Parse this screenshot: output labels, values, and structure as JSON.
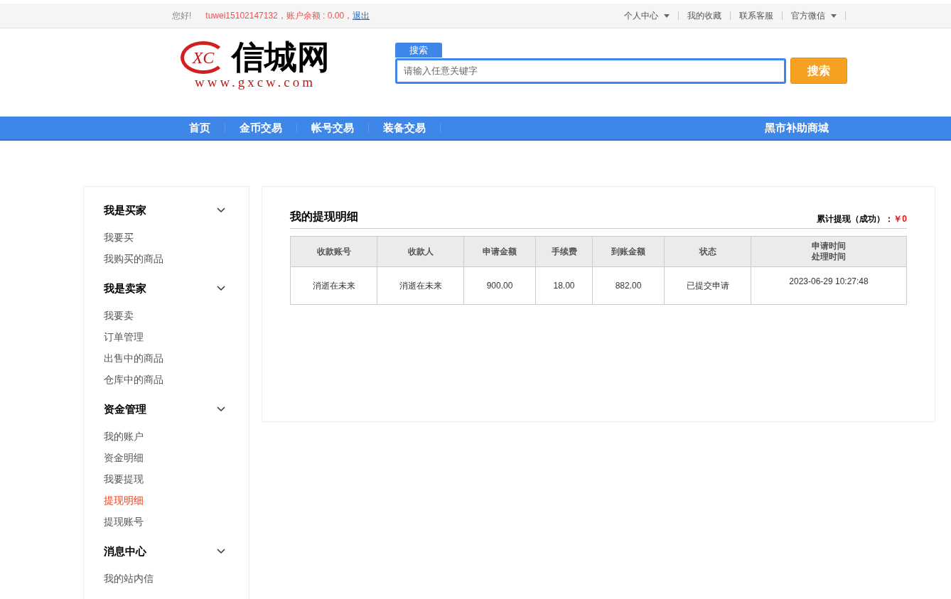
{
  "top_bar": {
    "greeting": "您好!",
    "username": "tuwei15102147132",
    "balance": "，账户余额 : 0.00，",
    "logout": "退出",
    "links": [
      {
        "label": "个人中心",
        "dropdown": true
      },
      {
        "label": "我的收藏",
        "dropdown": false
      },
      {
        "label": "联系客服",
        "dropdown": false
      },
      {
        "label": "官方微信",
        "dropdown": true
      }
    ]
  },
  "logo": {
    "mark": "XC",
    "name": "信城网",
    "url": "www.gxcw.com"
  },
  "search": {
    "tab": "搜索",
    "placeholder": "请输入任意关键字",
    "button": "搜索"
  },
  "nav": {
    "items": [
      "首页",
      "金币交易",
      "帐号交易",
      "装备交易"
    ],
    "right": "黑市补助商城"
  },
  "sidebar": [
    {
      "title": "我是买家",
      "expanded": true,
      "items": [
        {
          "label": "我要买",
          "selected": false
        },
        {
          "label": "我购买的商品",
          "selected": false
        }
      ]
    },
    {
      "title": "我是卖家",
      "expanded": true,
      "items": [
        {
          "label": "我要卖",
          "selected": false
        },
        {
          "label": "订单管理",
          "selected": false
        },
        {
          "label": "出售中的商品",
          "selected": false
        },
        {
          "label": "仓库中的商品",
          "selected": false
        }
      ]
    },
    {
      "title": "资金管理",
      "expanded": true,
      "items": [
        {
          "label": "我的账户",
          "selected": false
        },
        {
          "label": "资金明细",
          "selected": false
        },
        {
          "label": "我要提现",
          "selected": false
        },
        {
          "label": "提现明细",
          "selected": true
        },
        {
          "label": "提现账号",
          "selected": false
        }
      ]
    },
    {
      "title": "消息中心",
      "expanded": true,
      "items": [
        {
          "label": "我的站内信",
          "selected": false
        }
      ]
    }
  ],
  "main": {
    "title": "我的提现明细",
    "total_label": "累计提现（成功）：",
    "total_value": "￥0",
    "table": {
      "columns": [
        "收款账号",
        "收款人",
        "申请金额",
        "手续费",
        "到账金额",
        "状态",
        "申请时间处理时间"
      ],
      "rows": [
        [
          "消逝在未来",
          "消逝在未来",
          "900.00",
          "18.00",
          "882.00",
          "已提交申请",
          "2023-06-29 10:27:48"
        ]
      ]
    }
  }
}
